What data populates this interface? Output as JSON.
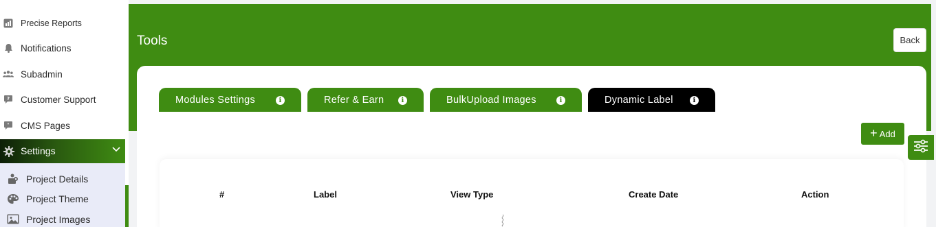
{
  "sidebar": {
    "items": [
      {
        "label": "Precise Reports",
        "icon": "chart-icon"
      },
      {
        "label": "Notifications",
        "icon": "bell-icon"
      },
      {
        "label": "Subadmin",
        "icon": "users-icon"
      },
      {
        "label": "Customer Support",
        "icon": "support-icon"
      },
      {
        "label": "CMS Pages",
        "icon": "chat-icon"
      }
    ],
    "settings": {
      "label": "Settings",
      "icon": "gear-icon"
    },
    "submenu": [
      {
        "label": "Project Details",
        "icon": "project-details-icon"
      },
      {
        "label": "Project Theme",
        "icon": "palette-icon"
      },
      {
        "label": "Project Images",
        "icon": "image-icon"
      }
    ]
  },
  "header": {
    "title": "Tools",
    "back_label": "Back"
  },
  "tabs": [
    {
      "label": "Modules Settings",
      "active": false
    },
    {
      "label": "Refer & Earn",
      "active": false
    },
    {
      "label": "BulkUpload Images",
      "active": false
    },
    {
      "label": "Dynamic Label",
      "active": true
    }
  ],
  "toolbar": {
    "add_label": "Add"
  },
  "table": {
    "columns": [
      "#",
      "Label",
      "View Type",
      "Create Date",
      "Action"
    ]
  },
  "colors": {
    "brand": "#3f8c12",
    "active_tab": "#000000",
    "submenu_bg": "#e9ebf8"
  }
}
